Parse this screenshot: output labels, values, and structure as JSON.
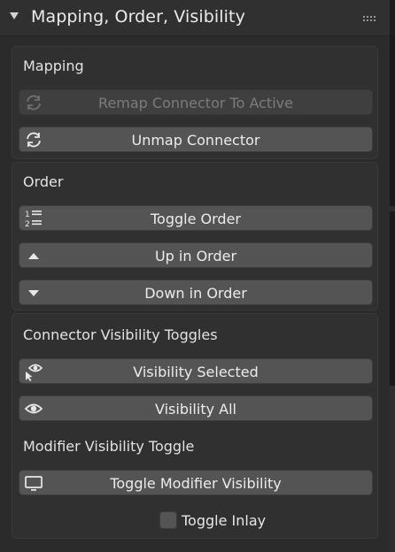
{
  "panel": {
    "title": "Mapping, Order, Visibility",
    "collapse_icon": "triangle-down-icon",
    "drag_icon": "grip-dots-icon"
  },
  "mapping": {
    "title": "Mapping",
    "remap_button": {
      "label": "Remap Connector To Active",
      "icon": "refresh-icon",
      "enabled": false
    },
    "unmap_button": {
      "label": "Unmap Connector",
      "icon": "refresh-icon",
      "enabled": true
    }
  },
  "order": {
    "title": "Order",
    "toggle_button": {
      "label": "Toggle Order",
      "icon": "numbered-list-icon"
    },
    "up_button": {
      "label": "Up in Order",
      "icon": "triangle-up-icon"
    },
    "down_button": {
      "label": "Down in Order",
      "icon": "triangle-down-icon"
    }
  },
  "visibility": {
    "connector_title": "Connector Visibility Toggles",
    "selected_button": {
      "label": "Visibility Selected",
      "icon": "eye-cursor-icon"
    },
    "all_button": {
      "label": "Visibility All",
      "icon": "eye-icon"
    },
    "modifier_title": "Modifier Visibility Toggle",
    "modifier_button": {
      "label": "Toggle Modifier Visibility",
      "icon": "monitor-icon"
    },
    "inlay_checkbox": {
      "label": "Toggle Inlay",
      "checked": false
    }
  },
  "colors": {
    "panel_bg": "#2b2b2b",
    "header_bg": "#303030",
    "button_bg": "#545454",
    "text": "#e6e6e6",
    "disabled_text": "#7c7c7c"
  }
}
